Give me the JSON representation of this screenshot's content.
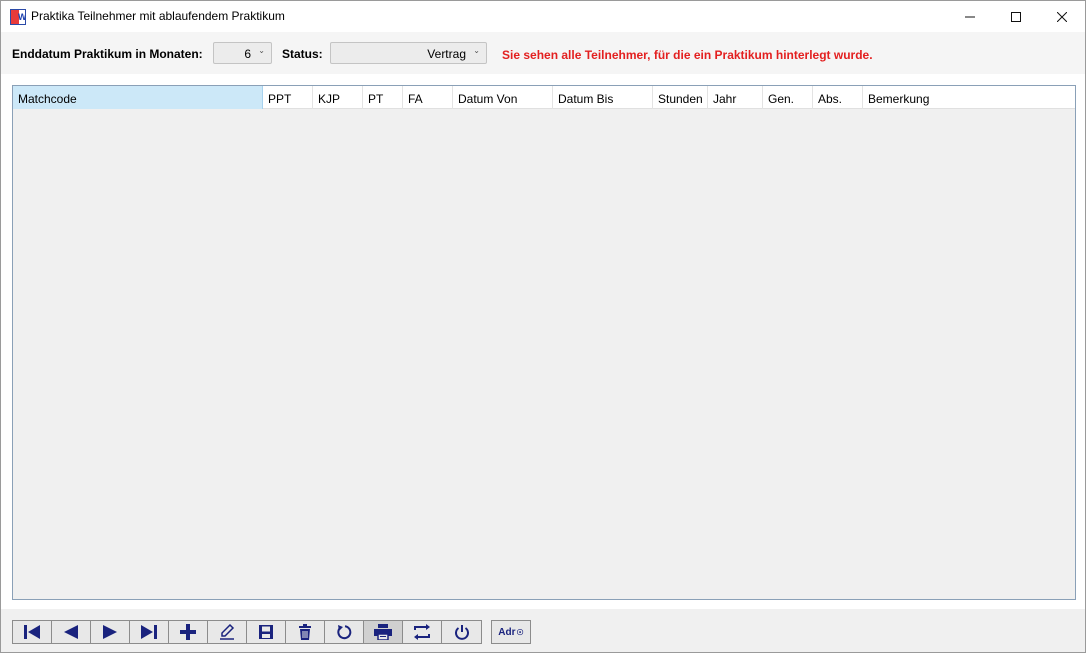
{
  "window": {
    "title": "Praktika Teilnehmer mit ablaufendem Praktikum",
    "app_icon": "rw-logo-icon"
  },
  "filters": {
    "enddatum_label": "Enddatum Praktikum in Monaten:",
    "enddatum_value": "6",
    "status_label": "Status:",
    "status_value": "Vertrag",
    "notice": "Sie sehen alle Teilnehmer, für die ein Praktikum hinterlegt wurde."
  },
  "grid": {
    "columns": [
      "Matchcode",
      "PPT",
      "KJP",
      "PT",
      "FA",
      "Datum Von",
      "Datum Bis",
      "Stunden",
      "Jahr",
      "Gen.",
      "Abs.",
      "Bemerkung"
    ],
    "rows": []
  },
  "toolbar": {
    "buttons": [
      "first-record-icon",
      "previous-record-icon",
      "next-record-icon",
      "last-record-icon",
      "add-icon",
      "edit-icon",
      "save-icon",
      "delete-icon",
      "refresh-icon",
      "print-icon",
      "swap-icon",
      "power-icon"
    ],
    "adr_label": "Adr"
  },
  "colors": {
    "notice": "#e32020",
    "icon_blue": "#1a237e",
    "header_active": "#cce8f8"
  }
}
